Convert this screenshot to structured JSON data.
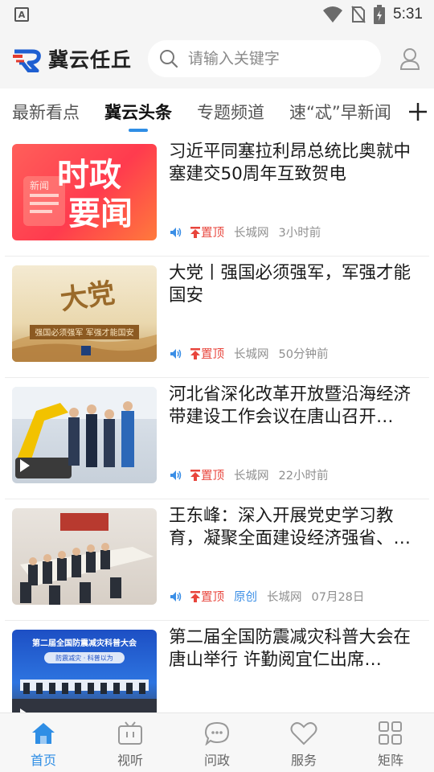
{
  "status_bar": {
    "time": "5:31",
    "left_icon": "A"
  },
  "header": {
    "app_name": "冀云任丘",
    "search_placeholder": "请输入关键字"
  },
  "tabs": [
    {
      "label": "最新看点",
      "active": false
    },
    {
      "label": "冀云头条",
      "active": true
    },
    {
      "label": "专题频道",
      "active": false
    },
    {
      "label": "速“忒”早新闻",
      "active": false
    }
  ],
  "thumb_texts": {
    "news_badge": "新闻",
    "shizheng_1": "时政",
    "shizheng_2": "要闻",
    "dadang": "大党",
    "dadang_banner": "强国必须强军 军强才能国安",
    "conference_banner": "第二届全国防震减灾科普大会",
    "conference_sub": "防震减灾 · 科普以为"
  },
  "news": [
    {
      "title": "习近平同塞拉利昂总统比奥就中塞建交50周年互致贺电",
      "pinned": "置顶",
      "original": "",
      "source": "长城网",
      "time": "3小时前",
      "video": false
    },
    {
      "title": "大党丨强国必须强军，军强才能国安",
      "pinned": "置顶",
      "original": "",
      "source": "长城网",
      "time": "50分钟前",
      "video": false
    },
    {
      "title": "河北省深化改革开放暨沿海经济带建设工作会议在唐山召开…",
      "pinned": "置顶",
      "original": "",
      "source": "长城网",
      "time": "22小时前",
      "video": true
    },
    {
      "title": "王东峰：深入开展党史学习教育，凝聚全面建设经济强省、…",
      "pinned": "置顶",
      "original": "原创",
      "source": "长城网",
      "time": "07月28日",
      "video": true
    },
    {
      "title": "第二届全国防震减灾科普大会在唐山举行 许勤阅宜仁出席…",
      "pinned": "",
      "original": "",
      "source": "",
      "time": "",
      "video": true
    }
  ],
  "bottom_nav": [
    {
      "label": "首页",
      "icon": "home-icon",
      "active": true
    },
    {
      "label": "视听",
      "icon": "tv-icon",
      "active": false
    },
    {
      "label": "问政",
      "icon": "chat-icon",
      "active": false
    },
    {
      "label": "服务",
      "icon": "heart-icon",
      "active": false
    },
    {
      "label": "矩阵",
      "icon": "grid-icon",
      "active": false
    }
  ],
  "colors": {
    "accent": "#2f8ee5",
    "pinned": "#e8453c",
    "original": "#3a8ee6"
  }
}
